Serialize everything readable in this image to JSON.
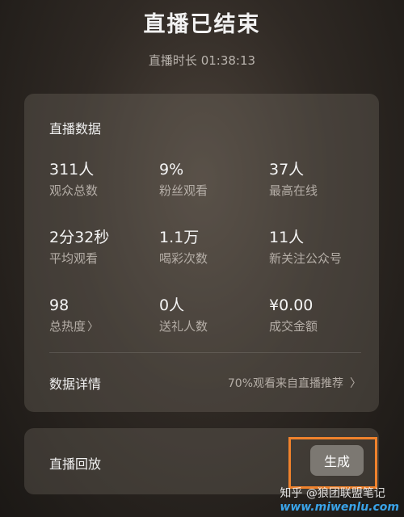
{
  "header": {
    "title": "直播已结束",
    "duration": "直播时长 01:38:13"
  },
  "stats": {
    "title": "直播数据",
    "items": [
      {
        "value": "311人",
        "label": "观众总数"
      },
      {
        "value": "9%",
        "label": "粉丝观看"
      },
      {
        "value": "37人",
        "label": "最高在线"
      },
      {
        "value": "2分32秒",
        "label": "平均观看"
      },
      {
        "value": "1.1万",
        "label": "喝彩次数"
      },
      {
        "value": "11人",
        "label": "新关注公众号"
      },
      {
        "value": "98",
        "label": "总热度"
      },
      {
        "value": "0人",
        "label": "送礼人数"
      },
      {
        "value": "¥0.00",
        "label": "成交金额"
      }
    ],
    "details_label": "数据详情",
    "details_note": "70%观看来自直播推荐"
  },
  "replay": {
    "label": "直播回放",
    "button": "生成"
  },
  "watermark": {
    "text": "知乎 @狼团联盟笔记",
    "url": "www.miwenlu.com"
  },
  "colors": {
    "highlight": "#f0822c",
    "watermark_url": "#3aa3e8"
  }
}
